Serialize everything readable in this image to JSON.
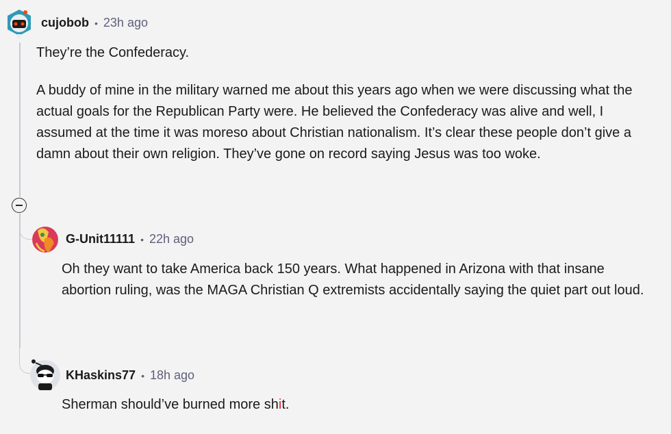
{
  "comments": [
    {
      "author": "cujobob",
      "separator": "•",
      "time": "23h ago",
      "paragraphs": [
        "They’re the Confederacy.",
        "A buddy of mine in the military warned me about this years ago when we were discussing what the actual goals for the Republican Party were. He believed the Confederacy was alive and well, I assumed at the time it was moreso about Christian nationalism. It’s clear these people don’t give a damn about their own religion. They’ve gone on record saying Jesus was too woke."
      ],
      "avatar_icon": "robot-avatar-icon"
    },
    {
      "author": "G-Unit11111",
      "separator": "•",
      "time": "22h ago",
      "paragraphs": [
        "Oh they want to take America back 150 years. What happened in Arizona with that insane abortion ruling, was the MAGA Christian Q extremists accidentally saying the quiet part out loud."
      ],
      "avatar_icon": "abstract-art-avatar-icon"
    },
    {
      "author": "KHaskins77",
      "separator": "•",
      "time": "18h ago",
      "body_before": "Sherman should’ve burned more sh",
      "body_mark": "i",
      "body_after": "t.",
      "avatar_icon": "snoo-sunglasses-avatar-icon"
    }
  ],
  "collapse_icon": "collapse-minus-icon",
  "colors": {
    "thread_line": "#c9c9d6",
    "meta_text": "#5f5f7a",
    "mark_red": "#e0262d",
    "background": "#f3f3f3"
  }
}
